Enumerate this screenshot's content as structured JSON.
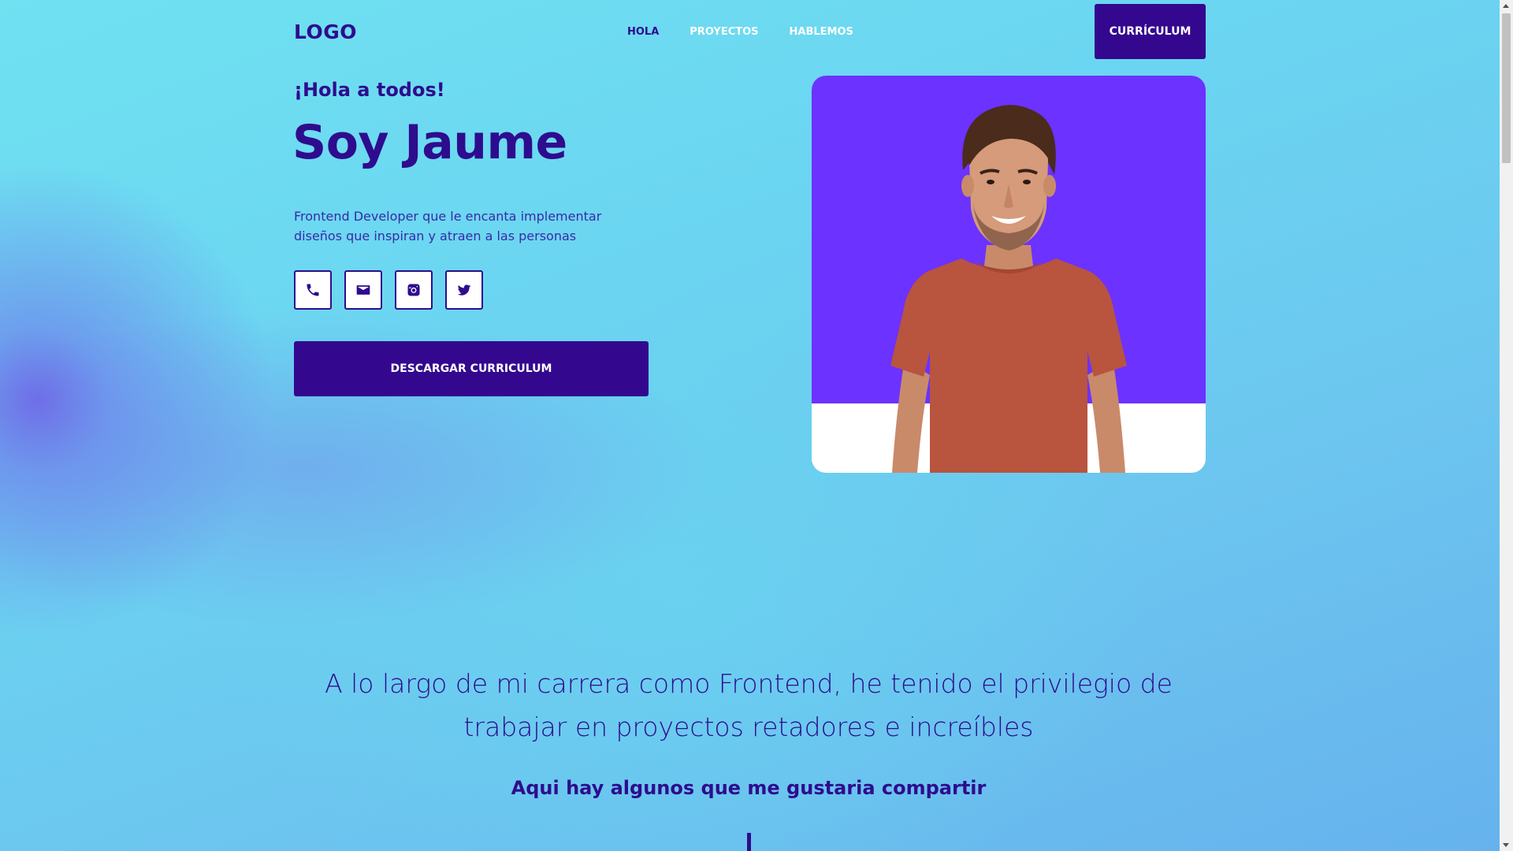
{
  "header": {
    "logo": "LOGO",
    "nav": [
      {
        "label": "HOLA",
        "active": true
      },
      {
        "label": "PROYECTOS",
        "active": false
      },
      {
        "label": "HABLEMOS",
        "active": false
      }
    ],
    "cv_button": "CURRÍCULUM"
  },
  "hero": {
    "greeting": "¡Hola a todos!",
    "title": "Soy Jaume",
    "description": "Frontend Developer que le encanta implementar diseños que inspiran y atraen a las personas",
    "socials": [
      {
        "icon": "phone-icon"
      },
      {
        "icon": "mail-icon"
      },
      {
        "icon": "instagram-icon"
      },
      {
        "icon": "twitter-icon"
      }
    ],
    "download_button": "DESCARGAR CURRICULUM"
  },
  "projects": {
    "intro": "A lo largo de mi carrera como Frontend, he tenido el privilegio de trabajar en proyectos retadores e increíbles",
    "subtitle": "Aqui hay algunos que me gustaria compartir"
  },
  "colors": {
    "primary": "#2e0c8e",
    "button": "#33088f",
    "photo_bg": "#6c32ff",
    "nav_inactive": "#ffffff"
  }
}
